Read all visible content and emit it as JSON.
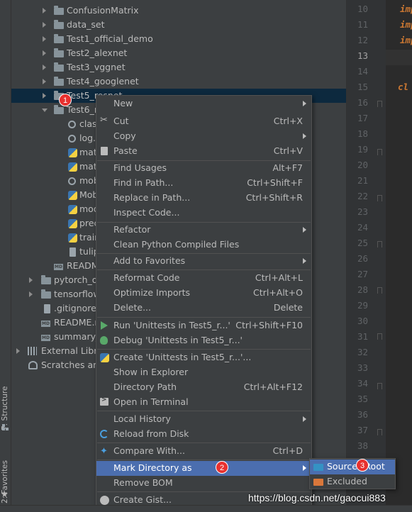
{
  "side_tabs": {
    "structure": "7: Structure",
    "favorites": "2: Favorites"
  },
  "tree": [
    {
      "label": "ConfusionMatrix",
      "icon": "folder-icon",
      "arrow": "right"
    },
    {
      "label": "data_set",
      "icon": "folder-icon",
      "arrow": "right"
    },
    {
      "label": "Test1_official_demo",
      "icon": "folder-icon",
      "arrow": "right"
    },
    {
      "label": "Test2_alexnet",
      "icon": "folder-icon",
      "arrow": "right"
    },
    {
      "label": "Test3_vggnet",
      "icon": "folder-icon",
      "arrow": "right"
    },
    {
      "label": "Test4_googlenet",
      "icon": "folder-icon",
      "arrow": "right"
    },
    {
      "label": "Test5_resnet",
      "icon": "folder-icon",
      "arrow": "right",
      "selected": true
    },
    {
      "label": "Test6_m",
      "icon": "folder-icon",
      "arrow": "down"
    },
    {
      "label": "clas",
      "icon": "gear-file-icon"
    },
    {
      "label": "log.",
      "icon": "gear-file-icon"
    },
    {
      "label": "mat",
      "icon": "python-file-icon"
    },
    {
      "label": "mat",
      "icon": "python-file-icon"
    },
    {
      "label": "mob",
      "icon": "gear-file-icon"
    },
    {
      "label": "Mob",
      "icon": "python-file-icon"
    },
    {
      "label": "mod",
      "icon": "python-file-icon"
    },
    {
      "label": "prec",
      "icon": "python-file-icon"
    },
    {
      "label": "train",
      "icon": "python-file-icon"
    },
    {
      "label": "tulip",
      "icon": "image-file-icon"
    },
    {
      "label": "READM",
      "icon": "markdown-file-icon"
    },
    {
      "label": "pytorch_ol",
      "icon": "folder-icon",
      "arrow": "right"
    },
    {
      "label": "tensorflow",
      "icon": "folder-icon",
      "arrow": "right"
    },
    {
      "label": ".gitignore",
      "icon": "git-file-icon"
    },
    {
      "label": "README.m",
      "icon": "markdown-file-icon"
    },
    {
      "label": "summary_",
      "icon": "markdown-file-icon"
    },
    {
      "label": "External Libra",
      "icon": "library-icon",
      "arrow": "right"
    },
    {
      "label": "Scratches and",
      "icon": "scratches-icon"
    }
  ],
  "editor": {
    "line_numbers": [
      "10",
      "11",
      "12",
      "13",
      "14",
      "15",
      "16",
      "17",
      "18",
      "19",
      "20",
      "21",
      "22",
      "23",
      "24",
      "25",
      "26",
      "27",
      "28",
      "29",
      "30",
      "31",
      "32",
      "33",
      "34",
      "35",
      "36",
      "37",
      "38"
    ],
    "current_line": "13",
    "tokens": {
      "imp1": "imp",
      "imp2": "imp",
      "imp3": "imp",
      "cl": "cl"
    }
  },
  "context_menu": {
    "items": [
      {
        "label": "New",
        "submenu": true
      },
      {
        "label": "Cut",
        "shortcut": "Ctrl+X",
        "icon": "cut-icon"
      },
      {
        "label": "Copy",
        "submenu": true
      },
      {
        "label": "Paste",
        "shortcut": "Ctrl+V",
        "icon": "paste-icon"
      },
      {
        "label": "Find Usages",
        "shortcut": "Alt+F7"
      },
      {
        "label": "Find in Path...",
        "shortcut": "Ctrl+Shift+F"
      },
      {
        "label": "Replace in Path...",
        "shortcut": "Ctrl+Shift+R"
      },
      {
        "label": "Inspect Code..."
      },
      {
        "label": "Refactor",
        "submenu": true
      },
      {
        "label": "Clean Python Compiled Files"
      },
      {
        "label": "Add to Favorites",
        "submenu": true
      },
      {
        "label": "Reformat Code",
        "shortcut": "Ctrl+Alt+L"
      },
      {
        "label": "Optimize Imports",
        "shortcut": "Ctrl+Alt+O"
      },
      {
        "label": "Delete...",
        "shortcut": "Delete"
      },
      {
        "label": "Run 'Unittests in Test5_r...'",
        "shortcut": "Ctrl+Shift+F10",
        "icon": "run-icon"
      },
      {
        "label": "Debug 'Unittests in Test5_r...'",
        "icon": "debug-icon"
      },
      {
        "label": "Create 'Unittests in Test5_r...'...",
        "icon": "python-create-icon"
      },
      {
        "label": "Show in Explorer"
      },
      {
        "label": "Directory Path",
        "shortcut": "Ctrl+Alt+F12"
      },
      {
        "label": "Open in Terminal",
        "icon": "terminal-icon"
      },
      {
        "label": "Local History",
        "submenu": true
      },
      {
        "label": "Reload from Disk",
        "icon": "reload-icon"
      },
      {
        "label": "Compare With...",
        "shortcut": "Ctrl+D",
        "icon": "compare-icon"
      },
      {
        "label": "Mark Directory as",
        "submenu": true,
        "selected": true
      },
      {
        "label": "Remove BOM"
      },
      {
        "label": "Create Gist...",
        "icon": "github-icon"
      }
    ]
  },
  "submenu": {
    "items": [
      {
        "label": "Sources Root",
        "icon": "blue-folder-icon",
        "selected": true
      },
      {
        "label": "Excluded",
        "icon": "orange-folder-icon"
      }
    ]
  },
  "badges": {
    "b1": "1",
    "b2": "2",
    "b3": "3"
  },
  "watermark": "https://blog.csdn.net/gaocui883",
  "colors": {
    "menu_highlight": "#4b6eaf",
    "tree_selection": "#0d293e",
    "badge": "#e8312f",
    "keyword": "#cc7832"
  }
}
